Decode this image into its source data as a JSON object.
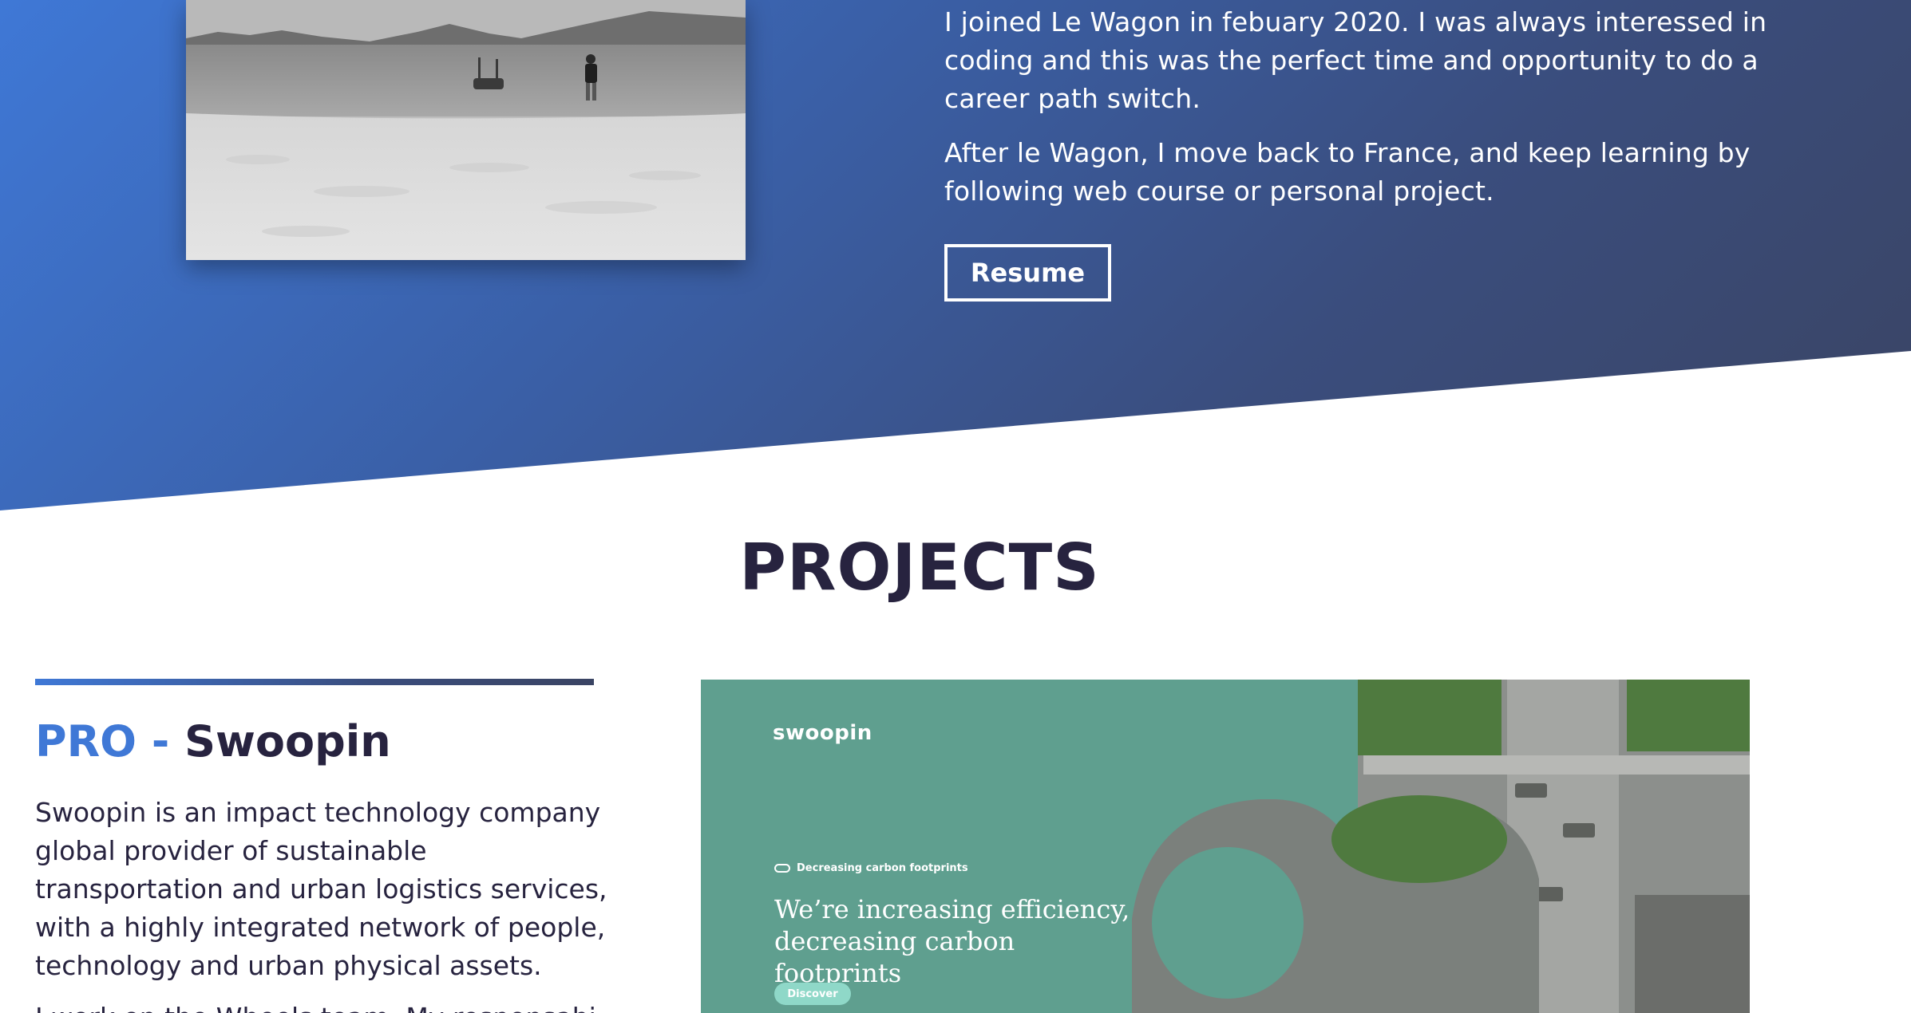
{
  "about": {
    "paragraph_1": "I joined Le Wagon in febuary 2020. I was always interessed in coding and this was the perfect time and opportunity to do a career path switch.",
    "paragraph_2": "After le Wagon, I move back to France, and keep learning by following web course or personal project.",
    "resume_label": "Resume"
  },
  "projects": {
    "title": "PROJECTS",
    "items": [
      {
        "tag": "PRO",
        "separator": "-",
        "name": "Swoopin",
        "description": "Swoopin is an impact technology company global provider of sustainable transportation and urban logistics services, with a highly integrated network of people, technology and urban physical assets.",
        "description_2": "I work on the Wheels team. My responsabi",
        "screenshot": {
          "logo": "swoopin",
          "tag_label": "Decreasing carbon footprints",
          "headline": "We’re increasing efficiency, decreasing carbon footprints",
          "discover_label": "Discover"
        }
      }
    ]
  },
  "colors": {
    "accent_blue": "#3f78d6",
    "dark_navy": "#27233f",
    "hero_end": "#3a4463",
    "swoopin_green": "#5f9f8f"
  }
}
